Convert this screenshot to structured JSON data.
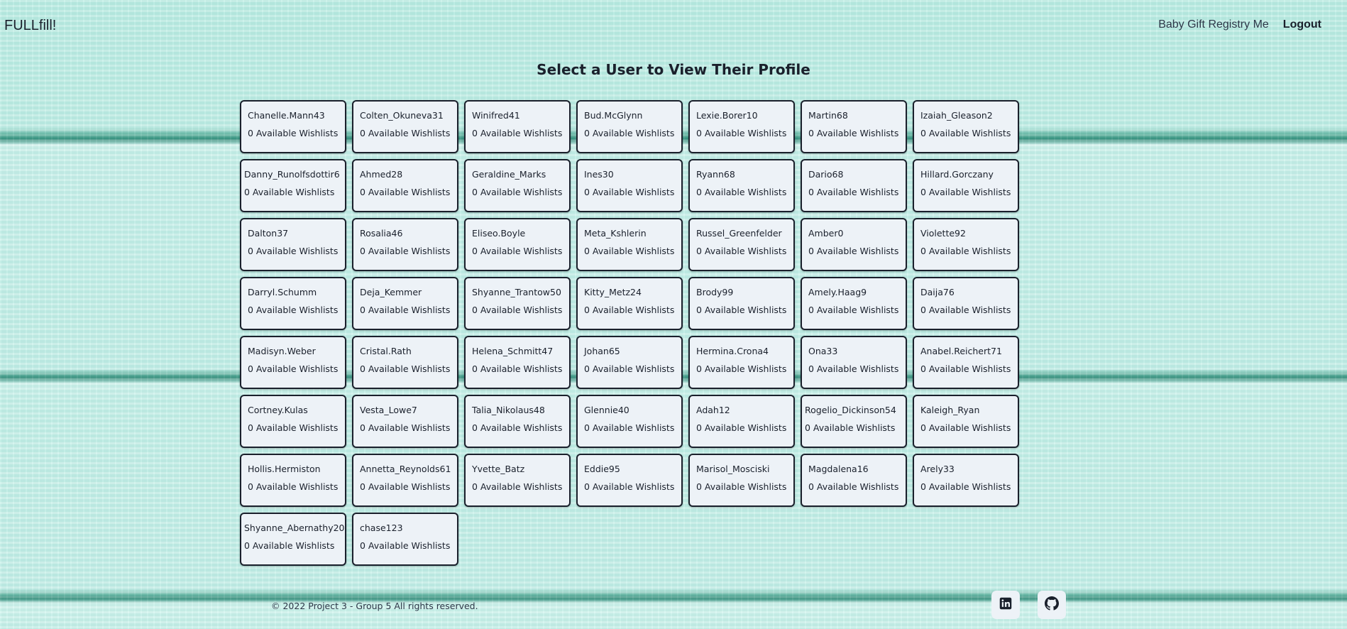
{
  "header": {
    "brand": "FULLfill!",
    "nav": {
      "registry_link": "Baby Gift Registry Me",
      "logout": "Logout"
    }
  },
  "main": {
    "heading": "Select a User to View Their Profile",
    "users": [
      {
        "name": "Chanelle.Mann43",
        "wishlists": "0 Available Wishlists"
      },
      {
        "name": "Colten_Okuneva31",
        "wishlists": "0 Available Wishlists"
      },
      {
        "name": "Winifred41",
        "wishlists": "0 Available Wishlists"
      },
      {
        "name": "Bud.McGlynn",
        "wishlists": "0 Available Wishlists"
      },
      {
        "name": "Lexie.Borer10",
        "wishlists": "0 Available Wishlists"
      },
      {
        "name": "Martin68",
        "wishlists": "0 Available Wishlists"
      },
      {
        "name": "Izaiah_Gleason2",
        "wishlists": "0 Available Wishlists"
      },
      {
        "name": "Danny_Runolfsdottir6",
        "wishlists": "0 Available Wishlists"
      },
      {
        "name": "Ahmed28",
        "wishlists": "0 Available Wishlists"
      },
      {
        "name": "Geraldine_Marks",
        "wishlists": "0 Available Wishlists"
      },
      {
        "name": "Ines30",
        "wishlists": "0 Available Wishlists"
      },
      {
        "name": "Ryann68",
        "wishlists": "0 Available Wishlists"
      },
      {
        "name": "Dario68",
        "wishlists": "0 Available Wishlists"
      },
      {
        "name": "Hillard.Gorczany",
        "wishlists": "0 Available Wishlists"
      },
      {
        "name": "Dalton37",
        "wishlists": "0 Available Wishlists"
      },
      {
        "name": "Rosalia46",
        "wishlists": "0 Available Wishlists"
      },
      {
        "name": "Eliseo.Boyle",
        "wishlists": "0 Available Wishlists"
      },
      {
        "name": "Meta_Kshlerin",
        "wishlists": "0 Available Wishlists"
      },
      {
        "name": "Russel_Greenfelder",
        "wishlists": "0 Available Wishlists"
      },
      {
        "name": "Amber0",
        "wishlists": "0 Available Wishlists"
      },
      {
        "name": "Violette92",
        "wishlists": "0 Available Wishlists"
      },
      {
        "name": "Darryl.Schumm",
        "wishlists": "0 Available Wishlists"
      },
      {
        "name": "Deja_Kemmer",
        "wishlists": "0 Available Wishlists"
      },
      {
        "name": "Shyanne_Trantow50",
        "wishlists": "0 Available Wishlists"
      },
      {
        "name": "Kitty_Metz24",
        "wishlists": "0 Available Wishlists"
      },
      {
        "name": "Brody99",
        "wishlists": "0 Available Wishlists"
      },
      {
        "name": "Amely.Haag9",
        "wishlists": "0 Available Wishlists"
      },
      {
        "name": "Daija76",
        "wishlists": "0 Available Wishlists"
      },
      {
        "name": "Madisyn.Weber",
        "wishlists": "0 Available Wishlists"
      },
      {
        "name": "Cristal.Rath",
        "wishlists": "0 Available Wishlists"
      },
      {
        "name": "Helena_Schmitt47",
        "wishlists": "0 Available Wishlists"
      },
      {
        "name": "Johan65",
        "wishlists": "0 Available Wishlists"
      },
      {
        "name": "Hermina.Crona4",
        "wishlists": "0 Available Wishlists"
      },
      {
        "name": "Ona33",
        "wishlists": "0 Available Wishlists"
      },
      {
        "name": "Anabel.Reichert71",
        "wishlists": "0 Available Wishlists"
      },
      {
        "name": "Cortney.Kulas",
        "wishlists": "0 Available Wishlists"
      },
      {
        "name": "Vesta_Lowe7",
        "wishlists": "0 Available Wishlists"
      },
      {
        "name": "Talia_Nikolaus48",
        "wishlists": "0 Available Wishlists"
      },
      {
        "name": "Glennie40",
        "wishlists": "0 Available Wishlists"
      },
      {
        "name": "Adah12",
        "wishlists": "0 Available Wishlists"
      },
      {
        "name": "Rogelio_Dickinson54",
        "wishlists": "0 Available Wishlists"
      },
      {
        "name": "Kaleigh_Ryan",
        "wishlists": "0 Available Wishlists"
      },
      {
        "name": "Hollis.Hermiston",
        "wishlists": "0 Available Wishlists"
      },
      {
        "name": "Annetta_Reynolds61",
        "wishlists": "0 Available Wishlists"
      },
      {
        "name": "Yvette_Batz",
        "wishlists": "0 Available Wishlists"
      },
      {
        "name": "Eddie95",
        "wishlists": "0 Available Wishlists"
      },
      {
        "name": "Marisol_Mosciski",
        "wishlists": "0 Available Wishlists"
      },
      {
        "name": "Magdalena16",
        "wishlists": "0 Available Wishlists"
      },
      {
        "name": "Arely33",
        "wishlists": "0 Available Wishlists"
      },
      {
        "name": "Shyanne_Abernathy20",
        "wishlists": "0 Available Wishlists"
      },
      {
        "name": "chase123",
        "wishlists": "0 Available Wishlists"
      }
    ]
  },
  "footer": {
    "copyright": "© 2022 Project 3 - Group 5 All rights reserved.",
    "icons": {
      "linkedin": "linkedin-icon",
      "github": "github-icon"
    }
  },
  "colors": {
    "card_bg": "#edf2f7",
    "card_border": "#1a202c",
    "text": "#1a202c",
    "background": "#c7f0e9"
  }
}
